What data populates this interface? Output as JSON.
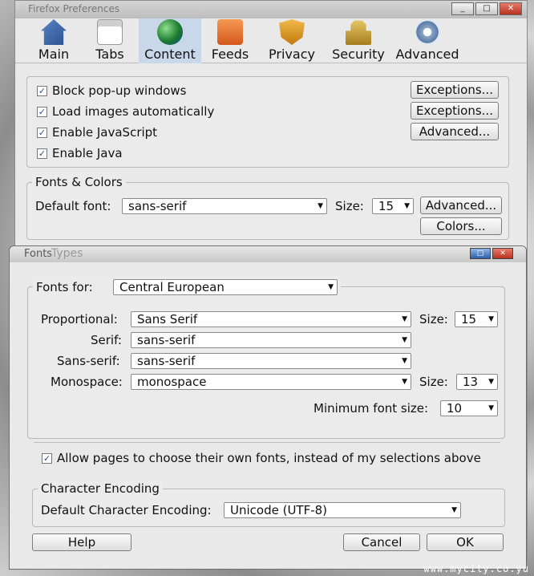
{
  "back_window": {
    "title": "Firefox Preferences",
    "window_buttons": [
      "_",
      "□",
      "✕"
    ],
    "toolbar": [
      {
        "label": "Main",
        "icon": "house-icon"
      },
      {
        "label": "Tabs",
        "icon": "tabs-icon"
      },
      {
        "label": "Content",
        "icon": "globe-icon",
        "selected": true
      },
      {
        "label": "Feeds",
        "icon": "rss-icon"
      },
      {
        "label": "Privacy",
        "icon": "shield-icon"
      },
      {
        "label": "Security",
        "icon": "padlock-icon"
      },
      {
        "label": "Advanced",
        "icon": "gear-icon"
      }
    ],
    "checks": [
      {
        "label": "Block pop-up windows",
        "checked": true
      },
      {
        "label": "Load images automatically",
        "checked": true
      },
      {
        "label": "Enable JavaScript",
        "checked": true
      },
      {
        "label": "Enable Java",
        "checked": true
      }
    ],
    "exceptions1": "Exceptions...",
    "exceptions2": "Exceptions...",
    "advanced_js": "Advanced...",
    "fonts_colors": {
      "legend": "Fonts & Colors",
      "default_font_label": "Default font:",
      "default_font_value": "sans-serif",
      "size_label": "Size:",
      "size_value": "15",
      "advanced_btn": "Advanced...",
      "colors_btn": "Colors..."
    }
  },
  "dialog": {
    "title": "Fonts",
    "title_overlap": "Types",
    "fonts_for_label": "Fonts for:",
    "fonts_for_value": "Central European",
    "proportional_label": "Proportional:",
    "proportional_value": "Sans Serif",
    "size_label": "Size:",
    "proportional_size": "15",
    "serif_label": "Serif:",
    "serif_value": "sans-serif",
    "sans_label": "Sans-serif:",
    "sans_value": "sans-serif",
    "mono_label": "Monospace:",
    "mono_value": "monospace",
    "mono_size": "13",
    "min_size_label": "Minimum font size:",
    "min_size_value": "10",
    "allow_pages": {
      "label": "Allow pages to choose their own fonts, instead of my selections above",
      "checked": true
    },
    "encoding_legend": "Character Encoding",
    "encoding_label": "Default Character Encoding:",
    "encoding_value": "Unicode (UTF-8)",
    "help": "Help",
    "cancel": "Cancel",
    "ok": "OK"
  },
  "watermark": "www.mycity.co.yu"
}
